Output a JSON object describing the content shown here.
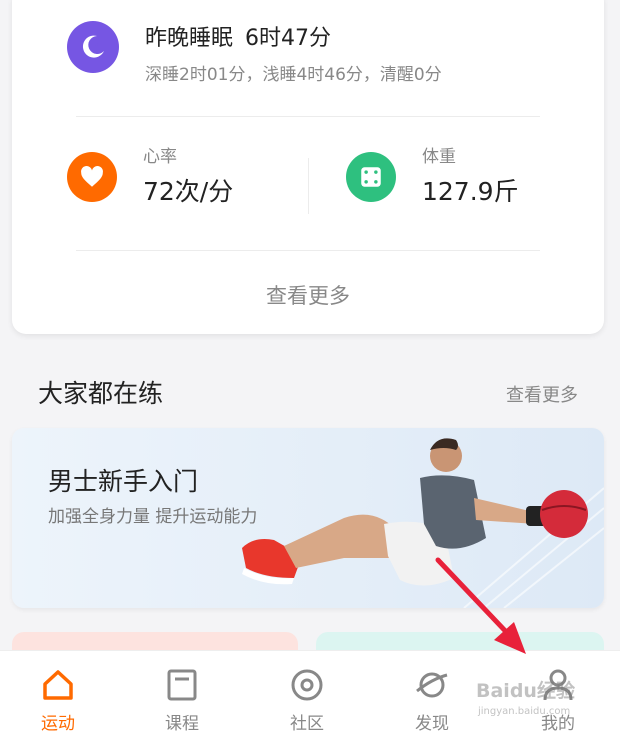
{
  "colors": {
    "accent": "#ff6a00",
    "sleep_icon": "#7656e3",
    "heart_icon": "#ff6a00",
    "weight_icon": "#2ec07f",
    "annotation_arrow": "#e8213a"
  },
  "health_card": {
    "sleep": {
      "icon": "moon-icon",
      "title": "昨晚睡眠",
      "duration": "6时47分",
      "detail": "深睡2时01分，浅睡4时46分，清醒0分"
    },
    "heart_rate": {
      "icon": "heart-icon",
      "label": "心率",
      "value": "72次/分"
    },
    "weight": {
      "icon": "scale-icon",
      "label": "体重",
      "value": "127.9斤"
    },
    "see_more": "查看更多"
  },
  "popular_section": {
    "title": "大家都在练",
    "see_more": "查看更多",
    "featured": {
      "title": "男士新手入门",
      "subtitle": "加强全身力量 提升运动能力"
    }
  },
  "tabbar": {
    "tabs": [
      {
        "label": "运动",
        "icon": "home-icon",
        "active": true
      },
      {
        "label": "课程",
        "icon": "course-icon",
        "active": false
      },
      {
        "label": "社区",
        "icon": "community-icon",
        "active": false
      },
      {
        "label": "发现",
        "icon": "discover-icon",
        "active": false
      },
      {
        "label": "我的",
        "icon": "profile-icon",
        "active": false
      }
    ]
  },
  "watermark": {
    "brand": "Baidu经验",
    "domain": "jingyan.baidu.com"
  }
}
